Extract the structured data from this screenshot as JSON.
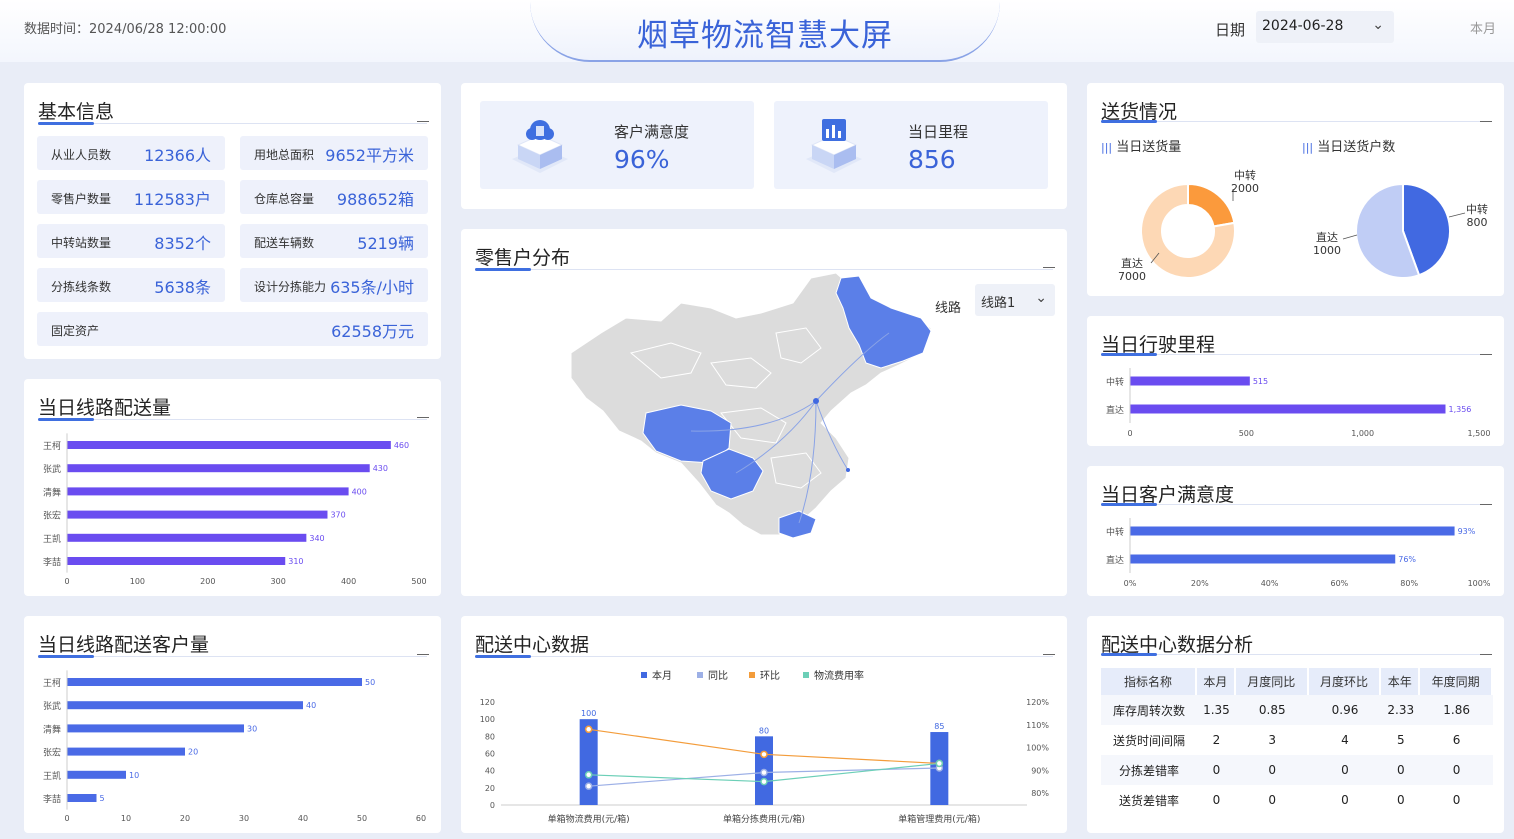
{
  "header": {
    "data_time": "数据时间：2024/06/28  12:00:00",
    "title": "烟草物流智慧大屏",
    "date_label": "日期",
    "date_value": "2024-06-28",
    "month_tag": "本月"
  },
  "basic_info": {
    "title": "基本信息",
    "items": [
      {
        "label": "从业人员数",
        "value": "12366人"
      },
      {
        "label": "用地总面积",
        "value": "9652平方米"
      },
      {
        "label": "零售户数量",
        "value": "112583户"
      },
      {
        "label": "仓库总容量",
        "value": "988652箱"
      },
      {
        "label": "中转站数量",
        "value": "8352个"
      },
      {
        "label": "配送车辆数",
        "value": "5219辆"
      },
      {
        "label": "分拣线条数",
        "value": "5638条"
      },
      {
        "label": "设计分拣能力",
        "value": "635条/小时"
      },
      {
        "label": "固定资产",
        "value": "62558万元"
      }
    ]
  },
  "kpis": [
    {
      "label": "客户满意度",
      "value": "96%",
      "icon": "cloud-cube-icon"
    },
    {
      "label": "当日里程",
      "value": "856",
      "icon": "chart-cube-icon"
    }
  ],
  "delivery": {
    "title": "送货情况",
    "left_legend": "当日送货量",
    "right_legend": "当日送货户数"
  },
  "retail_map": {
    "title": "零售户分布",
    "route_label": "线路",
    "route_value": "线路1"
  },
  "center_data": {
    "title": "配送中心数据",
    "legend": [
      "本月",
      "同比",
      "环比",
      "物流费用率"
    ]
  },
  "analysis": {
    "title": "配送中心数据分析",
    "headers": [
      "指标名称",
      "本月",
      "月度同比",
      "月度环比",
      "本年",
      "年度同期"
    ],
    "rows": [
      [
        "库存周转次数",
        "1.35",
        "0.85",
        "0.96",
        "2.33",
        "1.86"
      ],
      [
        "送货时间间隔",
        "2",
        "3",
        "4",
        "5",
        "6"
      ],
      [
        "分拣差错率",
        "0",
        "0",
        "0",
        "0",
        "0"
      ],
      [
        "送货差错率",
        "0",
        "0",
        "0",
        "0",
        "0"
      ]
    ]
  },
  "route_delivery_title": "当日线路配送量",
  "route_customer_title": "当日线路配送客户量",
  "mileage_title": "当日行驶里程",
  "satisfaction_title": "当日客户满意度",
  "chart_data": [
    {
      "type": "bar",
      "orientation": "horizontal",
      "id": "route-volume",
      "categories": [
        "王柯",
        "张武",
        "清舞",
        "张宏",
        "王凯",
        "李喆"
      ],
      "values": [
        460,
        430,
        400,
        370,
        340,
        310
      ],
      "xlim": [
        0,
        500
      ],
      "ticks": [
        "0",
        "100",
        "200",
        "300",
        "400",
        "500"
      ],
      "color": "#6a4cf0"
    },
    {
      "type": "bar",
      "orientation": "horizontal",
      "id": "route-customers",
      "categories": [
        "王柯",
        "张武",
        "清舞",
        "张宏",
        "王凯",
        "李喆"
      ],
      "values": [
        50,
        40,
        30,
        20,
        10,
        5
      ],
      "xlim": [
        0,
        60
      ],
      "ticks": [
        "0",
        "10",
        "20",
        "30",
        "40",
        "50",
        "60"
      ],
      "color": "#4a6ae6"
    },
    {
      "type": "bar",
      "orientation": "horizontal",
      "id": "mileage",
      "categories": [
        "中转",
        "直达"
      ],
      "values": [
        515,
        1356
      ],
      "value_labels": [
        "515",
        "1,356"
      ],
      "xlim": [
        0,
        1500
      ],
      "ticks": [
        "0",
        "500",
        "1,000",
        "1,500"
      ],
      "color": "#6a4cf0"
    },
    {
      "type": "bar",
      "orientation": "horizontal",
      "id": "satisfaction",
      "categories": [
        "中转",
        "直达"
      ],
      "values": [
        93,
        76
      ],
      "value_labels": [
        "93%",
        "76%"
      ],
      "xlim": [
        0,
        100
      ],
      "ticks": [
        "0%",
        "20%",
        "40%",
        "60%",
        "80%",
        "100%"
      ],
      "color": "#4a6ae6"
    },
    {
      "type": "pie",
      "id": "delivery-volume",
      "donut": true,
      "slices": [
        {
          "name": "中转",
          "value": 2000,
          "color": "#fb9a3c"
        },
        {
          "name": "直达",
          "value": 7000,
          "color": "#fdd8b5"
        }
      ]
    },
    {
      "type": "pie",
      "id": "delivery-households",
      "donut": false,
      "slices": [
        {
          "name": "中转",
          "value": 800,
          "color": "#4169e1"
        },
        {
          "name": "直达",
          "value": 1000,
          "color": "#c0cdf5"
        }
      ]
    },
    {
      "type": "bar+line",
      "id": "center-data",
      "categories": [
        "单箱物流费用(元/箱)",
        "单箱分拣费用(元/箱)",
        "单箱管理费用(元/箱)"
      ],
      "bar_series": {
        "name": "本月",
        "values": [
          100,
          80,
          85
        ],
        "color": "#4169e1"
      },
      "line_series": [
        {
          "name": "同比",
          "values": [
            83,
            89,
            91
          ],
          "color": "#9db0e6"
        },
        {
          "name": "环比",
          "values": [
            108,
            97,
            93
          ],
          "color": "#f39c3b"
        },
        {
          "name": "物流费用率",
          "values": [
            88,
            85,
            93
          ],
          "color": "#6ccfb7"
        }
      ],
      "left_axis": {
        "ticks": [
          "0",
          "20",
          "40",
          "60",
          "80",
          "100",
          "120"
        ],
        "range": [
          0,
          120
        ]
      },
      "right_axis": {
        "ticks": [
          "80%",
          "90%",
          "100%",
          "110%",
          "120%"
        ],
        "range": [
          80,
          120
        ]
      }
    }
  ]
}
